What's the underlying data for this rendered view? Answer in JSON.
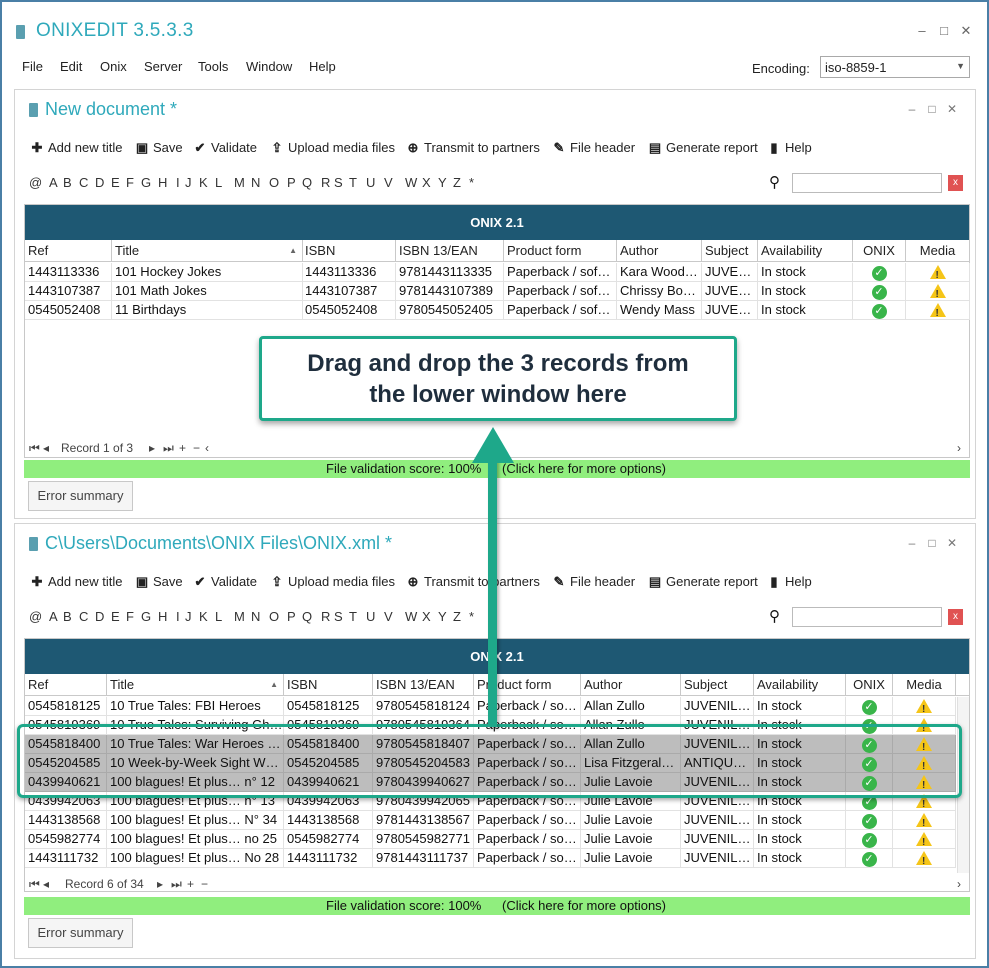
{
  "app": {
    "title": "ONIXEDIT 3.5.3.3",
    "window_controls": {
      "minimize": "–",
      "maximize": "□",
      "close": "✕"
    }
  },
  "menu": {
    "items": [
      "File",
      "Edit",
      "Onix",
      "Server",
      "Tools",
      "Window",
      "Help"
    ],
    "encoding_label": "Encoding:",
    "encoding_value": "iso-8859-1"
  },
  "toolbar": {
    "add_new_title": "Add new title",
    "save": "Save",
    "validate": "Validate",
    "upload_media": "Upload media files",
    "transmit": "Transmit to partners",
    "file_header": "File header",
    "generate_report": "Generate report",
    "help": "Help"
  },
  "alphabet": [
    "@",
    "A",
    "B",
    "C",
    "D",
    "E",
    "F",
    "G",
    "H",
    "I",
    "J",
    "K",
    "L",
    "M",
    "N",
    "O",
    "P",
    "Q",
    "R",
    "S",
    "T",
    "U",
    "V",
    "W",
    "X",
    "Y",
    "Z",
    "*"
  ],
  "top_window": {
    "title": "New document *",
    "grid_title": "ONIX 2.1",
    "columns": [
      "Ref",
      "Title",
      "ISBN",
      "ISBN 13/EAN",
      "Product form",
      "Author",
      "Subject",
      "Availability",
      "ONIX",
      "Media"
    ],
    "rows": [
      [
        "1443113336",
        "101 Hockey Jokes",
        "1443113336",
        "9781443113335",
        "Paperback / sof…",
        "Kara Wood…",
        "JUVE…",
        "In stock"
      ],
      [
        "1443107387",
        "101 Math Jokes",
        "1443107387",
        "9781443107389",
        "Paperback / sof…",
        "Chrissy Bo…",
        "JUVE…",
        "In stock"
      ],
      [
        "0545052408",
        "11 Birthdays",
        "0545052408",
        "9780545052405",
        "Paperback / sof…",
        "Wendy Mass",
        "JUVE…",
        "In stock"
      ]
    ],
    "record_nav": "Record 1 of 3",
    "validation_text": "File validation score: 100%",
    "validation_link": "(Click here for more options)",
    "error_summary": "Error summary"
  },
  "bottom_window": {
    "title": "C\\Users\\Documents\\ONIX Files\\ONIX.xml *",
    "grid_title": "ONIX 2.1",
    "columns": [
      "Ref",
      "Title",
      "ISBN",
      "ISBN 13/EAN",
      "Product form",
      "Author",
      "Subject",
      "Availability",
      "ONIX",
      "Media"
    ],
    "rows": [
      [
        "0545818125",
        "10 True Tales: FBI Heroes",
        "0545818125",
        "9780545818124",
        "Paperback / so…",
        "Allan Zullo",
        "JUVENIL…",
        "In stock"
      ],
      [
        "0545819369",
        "10 True Tales: Surviving Gh…",
        "0545819369",
        "9780545819364",
        "Paperback / so…",
        "Allan Zullo",
        "JUVENIL…",
        "In stock"
      ],
      [
        "0545818400",
        "10 True Tales: War Heroes …",
        "0545818400",
        "9780545818407",
        "Paperback / so…",
        "Allan Zullo",
        "JUVENIL…",
        "In stock"
      ],
      [
        "0545204585",
        "10 Week-by-Week Sight W…",
        "0545204585",
        "9780545204583",
        "Paperback / so…",
        "Lisa Fitzgeral…",
        "ANTIQU…",
        "In stock"
      ],
      [
        "0439940621",
        "100 blagues! Et plus… n° 12",
        "0439940621",
        "9780439940627",
        "Paperback / so…",
        "Julie Lavoie",
        "JUVENIL…",
        "In stock"
      ],
      [
        "0439942063",
        "100 blagues! Et plus… n° 13",
        "0439942063",
        "9780439942065",
        "Paperback / so…",
        "Julie Lavoie",
        "JUVENIL…",
        "In stock"
      ],
      [
        "1443138568",
        "100 blagues! Et plus… N° 34",
        "1443138568",
        "9781443138567",
        "Paperback / so…",
        "Julie Lavoie",
        "JUVENIL…",
        "In stock"
      ],
      [
        "0545982774",
        "100 blagues! Et plus… no 25",
        "0545982774",
        "9780545982771",
        "Paperback / so…",
        "Julie Lavoie",
        "JUVENIL…",
        "In stock"
      ],
      [
        "1443111732",
        "100 blagues! Et plus… No 28",
        "1443111732",
        "9781443111737",
        "Paperback / so…",
        "Julie Lavoie",
        "JUVENIL…",
        "In stock"
      ]
    ],
    "selected_rows": [
      2,
      3,
      4
    ],
    "record_nav": "Record 6 of 34",
    "validation_text": "File validation score: 100%",
    "validation_link": "(Click here for more options)",
    "error_summary": "Error summary"
  },
  "callout": {
    "line1": "Drag and drop the 3 records from",
    "line2": "the lower window here"
  },
  "colors": {
    "accent": "#2fa9bb",
    "grid_header": "#1e5873",
    "validation_bg": "#90ee7e",
    "callout_border": "#1ea88a",
    "selected_row": "#bdbdbd"
  }
}
